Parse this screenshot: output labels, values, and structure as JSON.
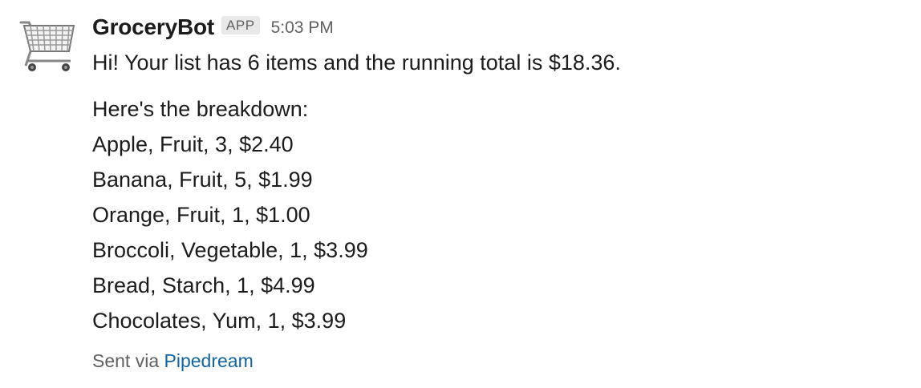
{
  "message": {
    "sender": "GroceryBot",
    "badge": "APP",
    "time": "5:03 PM",
    "intro": "Hi! Your list has 6 items and the running total is $18.36.",
    "breakdown_heading": "Here's the breakdown:",
    "items": [
      "Apple, Fruit, 3, $2.40",
      "Banana, Fruit, 5, $1.99",
      "Orange, Fruit, 1, $1.00",
      "Broccoli, Vegetable, 1, $3.99",
      "Bread, Starch, 1, $4.99",
      "Chocolates, Yum, 1, $3.99"
    ],
    "footer_prefix": "Sent via",
    "footer_link": "Pipedream"
  },
  "icons": {
    "avatar": "shopping-cart-icon"
  },
  "colors": {
    "text": "#1d1c1d",
    "muted": "#616061",
    "link": "#1264a3",
    "badge_bg": "#e8e8e8"
  }
}
